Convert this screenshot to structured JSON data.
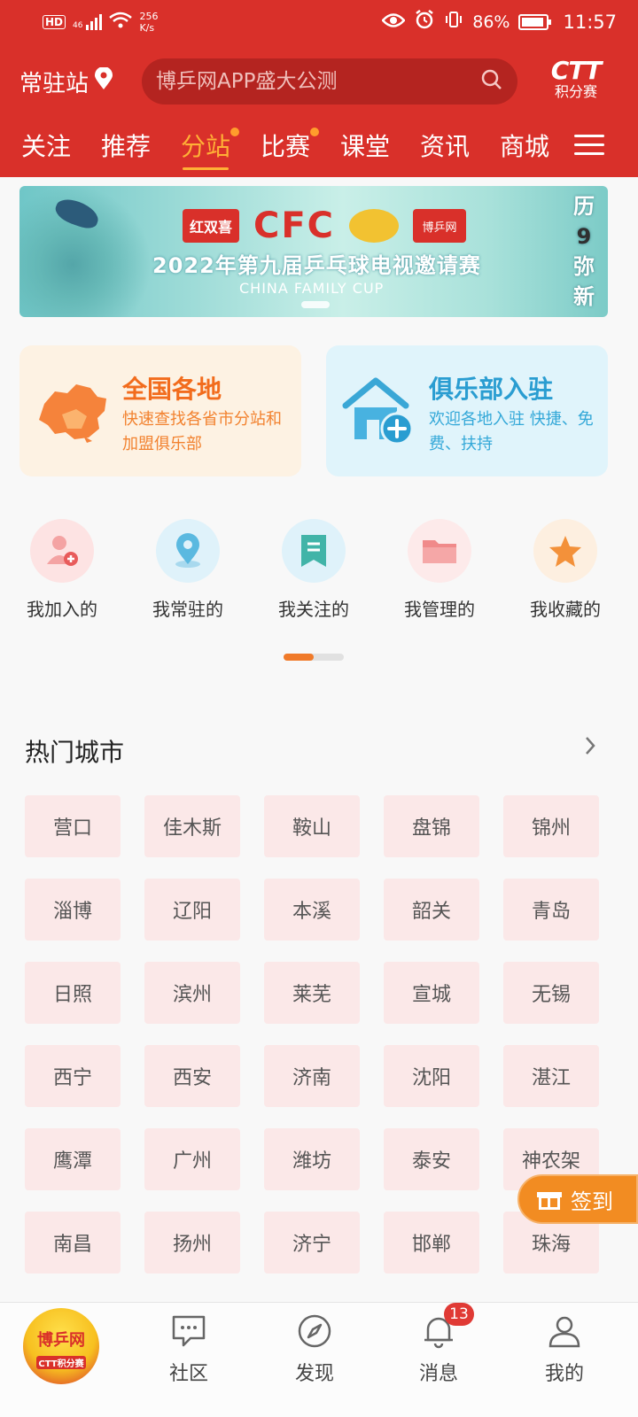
{
  "status_bar": {
    "network": "HD",
    "signal_small": "46",
    "speed_value": "256",
    "speed_unit": "K/s",
    "battery": "86%",
    "time": "11:57"
  },
  "header": {
    "location": "常驻站",
    "search_placeholder": "博乒网APP盛大公测",
    "brand_big": "CTT",
    "brand_small": "积分赛",
    "tabs": [
      {
        "label": "关注"
      },
      {
        "label": "推荐"
      },
      {
        "label": "分站"
      },
      {
        "label": "比赛"
      },
      {
        "label": "课堂"
      },
      {
        "label": "资讯"
      },
      {
        "label": "商城"
      }
    ]
  },
  "banner": {
    "logo1": "红双喜",
    "logo2": "CFC",
    "logo3": "博乒网",
    "title": "2022年第九届乒乓球电视邀请赛",
    "subtitle": "CHINA FAMILY CUP",
    "side_chars": [
      "历",
      "9",
      "弥",
      "新"
    ]
  },
  "cards": [
    {
      "title": "全国各地",
      "desc": "快速查找各省市分站和加盟俱乐部"
    },
    {
      "title": "俱乐部入驻",
      "desc": "欢迎各地入驻 快捷、免费、扶持"
    }
  ],
  "quick_links": [
    {
      "label": "我加入的",
      "icon": "user-add-icon"
    },
    {
      "label": "我常驻的",
      "icon": "location-pin-icon"
    },
    {
      "label": "我关注的",
      "icon": "bookmark-icon"
    },
    {
      "label": "我管理的",
      "icon": "folder-icon"
    },
    {
      "label": "我收藏的",
      "icon": "star-icon"
    }
  ],
  "hot_cities": {
    "title": "热门城市",
    "cities": [
      "营口",
      "佳木斯",
      "鞍山",
      "盘锦",
      "锦州",
      "淄博",
      "辽阳",
      "本溪",
      "韶关",
      "青岛",
      "日照",
      "滨州",
      "莱芜",
      "宣城",
      "无锡",
      "西宁",
      "西安",
      "济南",
      "沈阳",
      "湛江",
      "鹰潭",
      "广州",
      "潍坊",
      "泰安",
      "神农架",
      "南昌",
      "扬州",
      "济宁",
      "邯郸",
      "珠海"
    ]
  },
  "signin": {
    "label": "签到"
  },
  "bottom_nav": {
    "home_logo_text": "博乒网",
    "home_logo_sub": "CTT积分赛",
    "items": [
      {
        "label": "社区"
      },
      {
        "label": "发现"
      },
      {
        "label": "消息",
        "badge": "13"
      },
      {
        "label": "我的"
      }
    ]
  },
  "colors": {
    "brand_red": "#d9302a",
    "active_tab": "#ffb036",
    "orange": "#f26c1d",
    "blue": "#2a9dd1"
  }
}
